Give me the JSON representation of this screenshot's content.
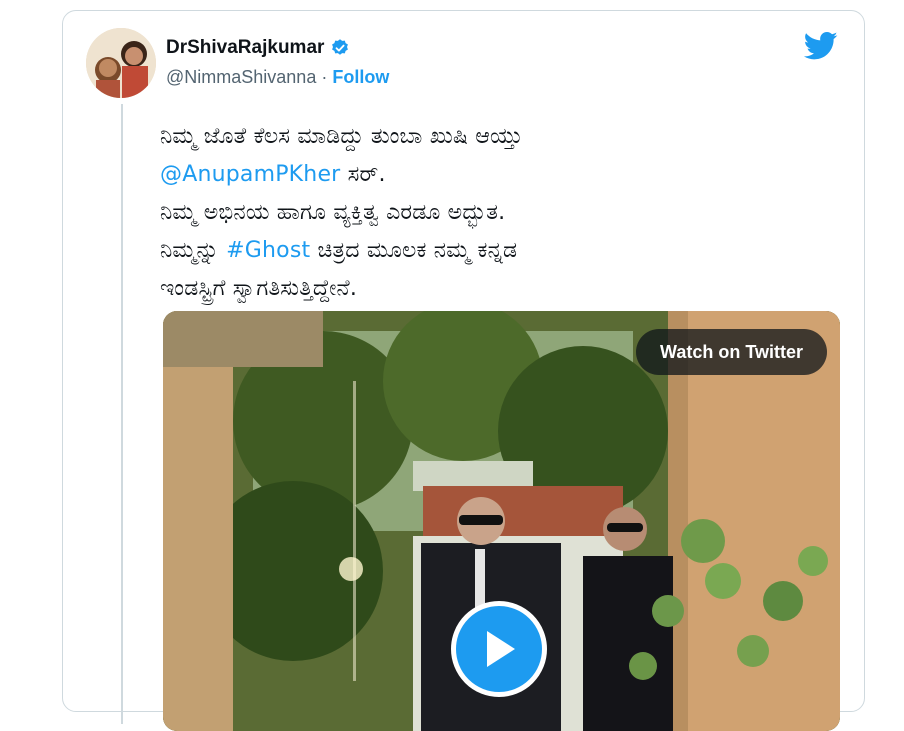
{
  "tweet": {
    "display_name": "DrShivaRajkumar",
    "handle": "@NimmaShivanna",
    "separator": "·",
    "follow_label": "Follow",
    "lines": [
      {
        "parts": [
          {
            "text": "ನಿಮ್ಮ ಜೊತೆ ಕೆಲಸ ಮಾಡಿದ್ದು ತುಂಬಾ ಖುಷಿ ಆಯ್ತು",
            "link": false
          }
        ]
      },
      {
        "parts": [
          {
            "text": "@AnupamPKher",
            "link": true
          },
          {
            "text": " ಸರ್.",
            "link": false
          }
        ]
      },
      {
        "parts": [
          {
            "text": "ನಿಮ್ಮ ಅಭಿನಯ ಹಾಗೂ ವ್ಯಕ್ತಿತ್ವ ಎರಡೂ ಅದ್ಭುತ.",
            "link": false
          }
        ]
      },
      {
        "parts": [
          {
            "text": "ನಿಮ್ಮನ್ನು ",
            "link": false
          },
          {
            "text": "#Ghost",
            "link": true
          },
          {
            "text": " ಚಿತ್ರದ ಮೂಲಕ ನಮ್ಮ ಕನ್ನಡ",
            "link": false
          }
        ]
      },
      {
        "parts": [
          {
            "text": "ಇಂಡಸ್ಟ್ರಿಗೆ ಸ್ವಾಗತಿಸುತ್ತಿದ್ದೇನೆ.",
            "link": false
          }
        ]
      }
    ]
  },
  "media": {
    "watch_label": "Watch on Twitter",
    "play_icon": "play-icon"
  },
  "icons": {
    "verified": "verified-badge-icon",
    "brand": "twitter-bird-icon"
  },
  "colors": {
    "accent": "#1d9bf0",
    "text": "#0f1419",
    "muted": "#536471",
    "border": "#cfd9de"
  }
}
